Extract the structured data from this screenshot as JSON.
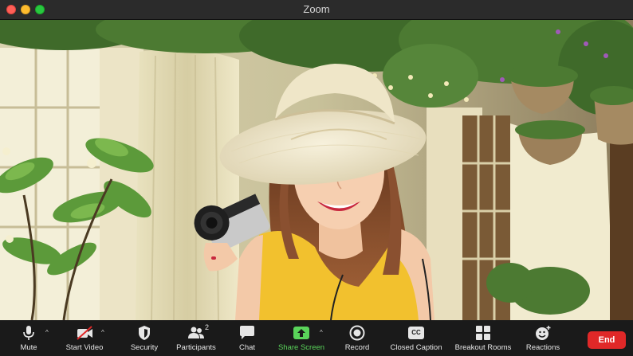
{
  "window": {
    "title": "Zoom"
  },
  "toolbar": {
    "mute": "Mute",
    "start_video": "Start Video",
    "security": "Security",
    "participants": "Participants",
    "participants_count": "2",
    "chat": "Chat",
    "share_screen": "Share Screen",
    "record": "Record",
    "closed_caption": "Closed Caption",
    "cc_glyph": "CC",
    "breakout_rooms": "Breakout Rooms",
    "reactions": "Reactions",
    "end": "End",
    "caret": "^"
  },
  "colors": {
    "share_green": "#5ad45a",
    "end_red": "#e02828",
    "toolbar_bg": "#1a1a1a",
    "dress_yellow": "#f2c12e"
  }
}
